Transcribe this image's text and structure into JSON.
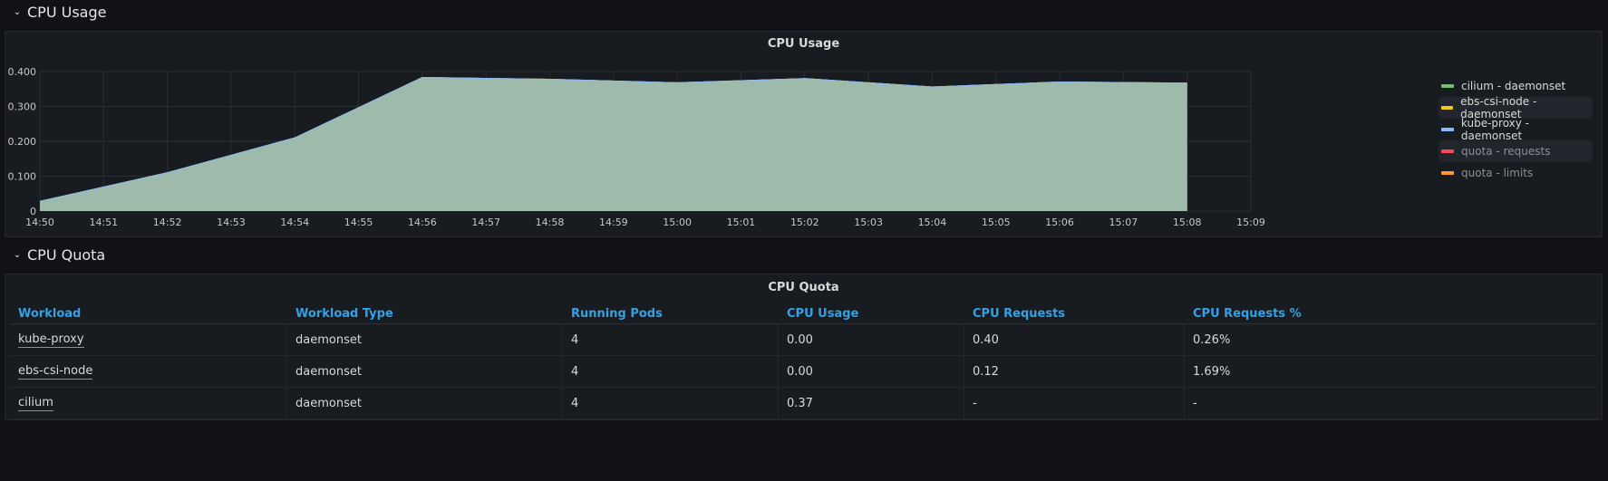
{
  "rows": {
    "usage_title": "CPU Usage",
    "quota_title": "CPU Quota"
  },
  "usage_panel": {
    "title": "CPU Usage",
    "legend": [
      {
        "label": "cilium - daemonset",
        "color": "#73bf69",
        "state": "normal"
      },
      {
        "label": "ebs-csi-node - daemonset",
        "color": "#f2cc0c",
        "state": "highlight"
      },
      {
        "label": "kube-proxy - daemonset",
        "color": "#8ab8ff",
        "state": "normal"
      },
      {
        "label": "quota - requests",
        "color": "#f2495c",
        "state": "dim"
      },
      {
        "label": "quota - limits",
        "color": "#ff9830",
        "state": "dim"
      }
    ]
  },
  "chart_data": {
    "type": "area",
    "title": "CPU Usage",
    "x": [
      "14:50",
      "14:52",
      "14:54",
      "14:56",
      "14:58",
      "15:00",
      "15:02",
      "15:04",
      "15:06",
      "15:08"
    ],
    "x_ticks": [
      "14:50",
      "14:51",
      "14:52",
      "14:53",
      "14:54",
      "14:55",
      "14:56",
      "14:57",
      "14:58",
      "14:59",
      "15:00",
      "15:01",
      "15:02",
      "15:03",
      "15:04",
      "15:05",
      "15:06",
      "15:07",
      "15:08",
      "15:09"
    ],
    "y_ticks": [
      "0",
      "0.100",
      "0.200",
      "0.300",
      "0.400"
    ],
    "ylim": [
      0,
      0.4
    ],
    "stacked": true,
    "series": [
      {
        "name": "cilium - daemonset",
        "color": "#73bf69",
        "values": [
          0.028,
          0.11,
          0.21,
          0.383,
          0.378,
          0.368,
          0.38,
          0.356,
          0.37,
          0.367
        ]
      },
      {
        "name": "ebs-csi-node - daemonset",
        "color": "#f2cc0c",
        "values": [
          0.0,
          0.0,
          0.0,
          0.0,
          0.0,
          0.0,
          0.0,
          0.0,
          0.0,
          0.0
        ]
      },
      {
        "name": "kube-proxy - daemonset",
        "color": "#8ab8ff",
        "values": [
          0.0,
          0.0,
          0.0,
          0.0,
          0.0,
          0.0,
          0.0,
          0.0,
          0.0,
          0.0
        ]
      }
    ],
    "grid": true,
    "legend_position": "right"
  },
  "quota_panel": {
    "title": "CPU Quota",
    "columns": [
      "Workload",
      "Workload Type",
      "Running Pods",
      "CPU Usage",
      "CPU Requests",
      "CPU Requests %"
    ],
    "rows": [
      {
        "workload": "kube-proxy",
        "type": "daemonset",
        "pods": "4",
        "usage": "0.00",
        "requests": "0.40",
        "requests_pct": "0.26%"
      },
      {
        "workload": "ebs-csi-node",
        "type": "daemonset",
        "pods": "4",
        "usage": "0.00",
        "requests": "0.12",
        "requests_pct": "1.69%"
      },
      {
        "workload": "cilium",
        "type": "daemonset",
        "pods": "4",
        "usage": "0.37",
        "requests": "-",
        "requests_pct": "-"
      }
    ]
  }
}
